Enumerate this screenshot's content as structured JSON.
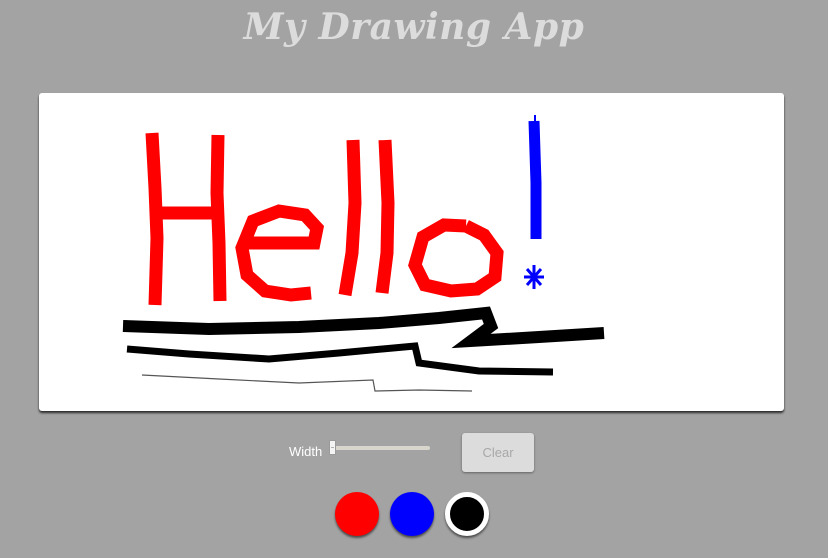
{
  "header": {
    "title": "My Drawing App"
  },
  "controls": {
    "width_label": "Width",
    "width_value": 0,
    "clear_label": "Clear"
  },
  "palette": {
    "colors": [
      {
        "name": "red",
        "hex": "#ff0000",
        "selected": false
      },
      {
        "name": "blue",
        "hex": "#0000ff",
        "selected": false
      },
      {
        "name": "black",
        "hex": "#000000",
        "selected": true
      }
    ]
  },
  "canvas": {
    "background": "#ffffff",
    "drawing_text": "Hello!"
  }
}
